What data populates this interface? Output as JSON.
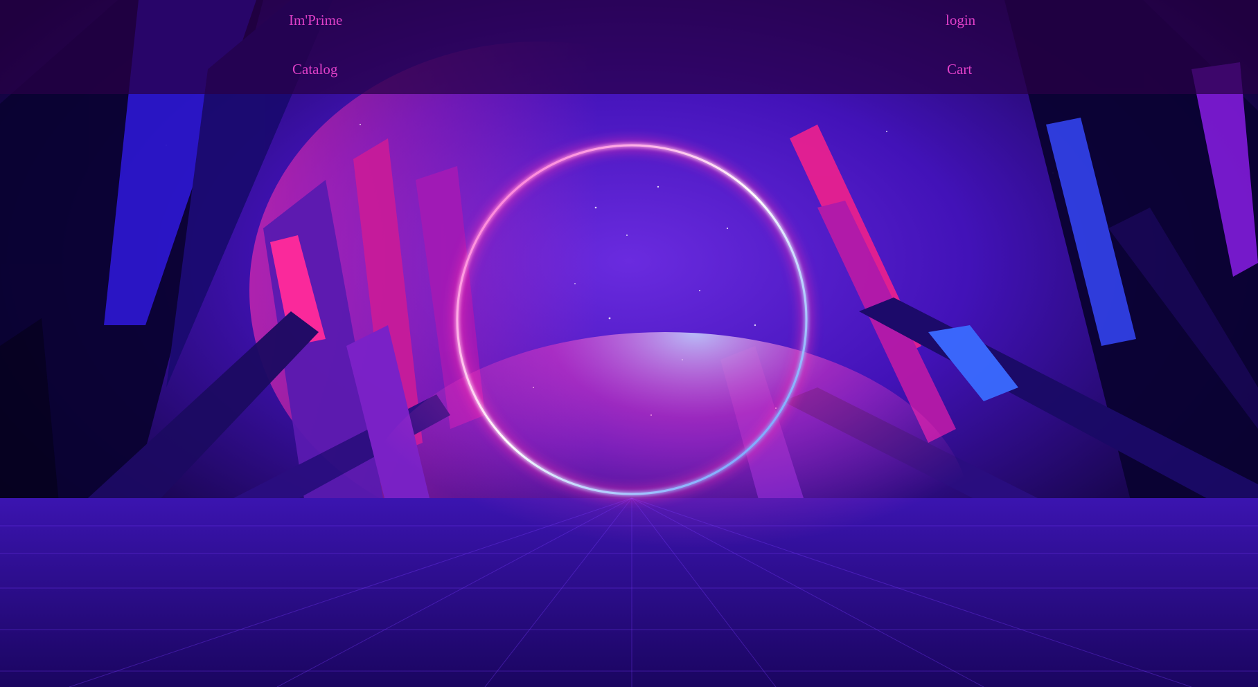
{
  "nav": {
    "brand": "Im'Prime",
    "login": "login",
    "catalog": "Catalog",
    "cart": "Cart"
  },
  "theme": {
    "link_color": "#e040c8",
    "nav_background": "#280046",
    "ring_pink": "#ff2fb0",
    "ring_blue": "#2f6bff",
    "sky": "#4a12c8"
  }
}
